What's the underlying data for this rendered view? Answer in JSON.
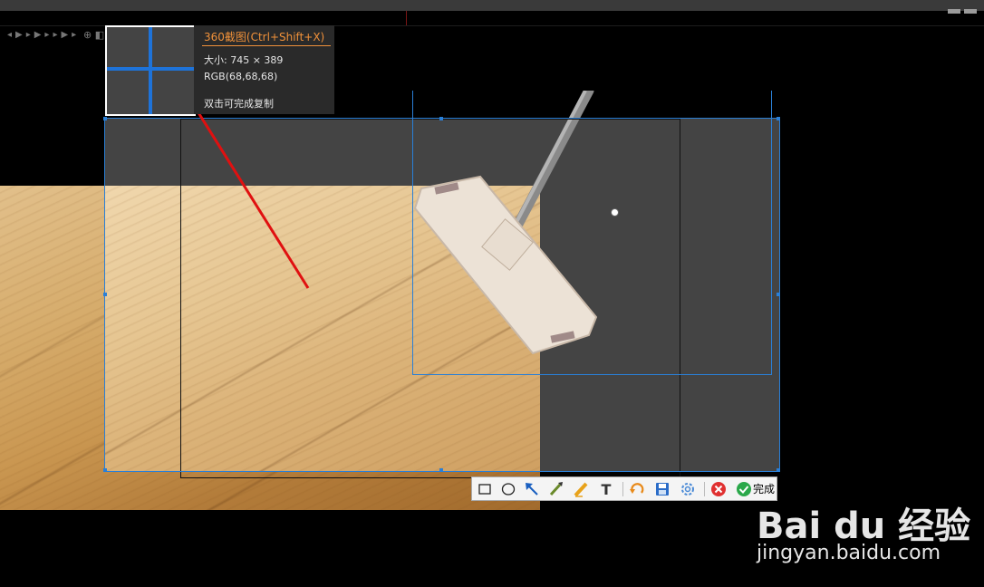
{
  "app": "360截图",
  "magnifier_info": {
    "title": "360截图(Ctrl+Shift+X)",
    "size": "大小: 745 × 389",
    "rgb": "RGB(68,68,68)",
    "hint": "双击可完成复制"
  },
  "toolbar": {
    "tools": [
      {
        "name": "rectangle-tool-icon",
        "glyph": "□"
      },
      {
        "name": "ellipse-tool-icon",
        "glyph": "○"
      },
      {
        "name": "arrow-tool-icon",
        "glyph": "↖"
      },
      {
        "name": "brush-tool-icon",
        "glyph": "✎"
      },
      {
        "name": "highlighter-tool-icon",
        "glyph": "✏"
      },
      {
        "name": "text-tool-icon",
        "glyph": "T"
      },
      {
        "name": "undo-icon",
        "glyph": "↶"
      },
      {
        "name": "save-icon",
        "glyph": "💾"
      },
      {
        "name": "settings-icon",
        "glyph": "✿"
      },
      {
        "name": "cancel-icon",
        "glyph": "✖"
      }
    ],
    "done_label": "完成"
  },
  "watermark": {
    "logo": "Bai du 经验",
    "url": "jingyan.baidu.com"
  },
  "colors": {
    "selection_border": "#2a7fd6",
    "title_accent": "#f0913a",
    "annotation_arrow": "#e01010"
  }
}
